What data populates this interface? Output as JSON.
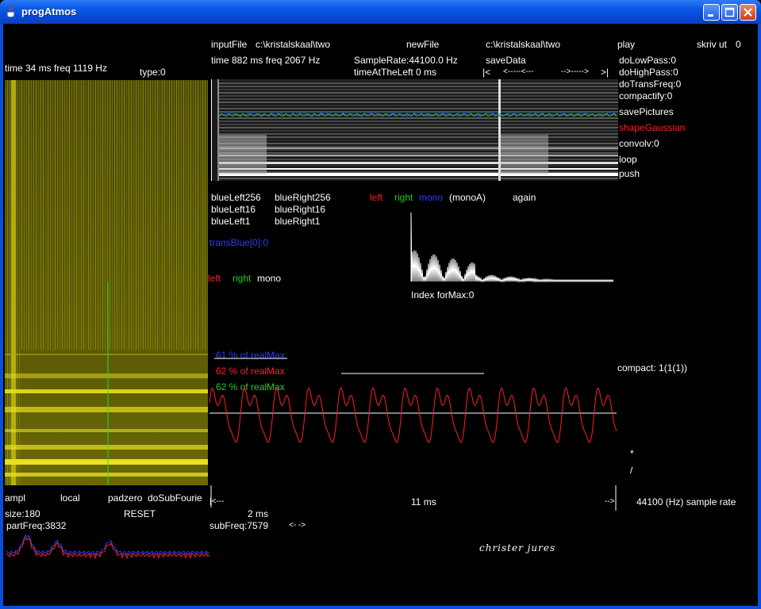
{
  "window": {
    "title": "progAtmos",
    "colors": {
      "titlebar": "#0a5ae8",
      "background": "#000000",
      "yellow": "#e0d818"
    }
  },
  "top": {
    "input_file_label": "inputFile",
    "input_file_path": "c:\\kristalskaal\\two",
    "new_file_label": "newFile",
    "new_file_path": "c:\\kristalskaal\\two",
    "play": "play",
    "skriv_ut": "skriv ut",
    "skriv_ut_value": "0",
    "time_freq_right": "time  882 ms   freq  2067 Hz",
    "sample_rate": "SampleRate:44100.0 Hz",
    "time_at_left": "timeAtTheLeft  0 ms",
    "save_data": "saveData",
    "nav_start": "|<",
    "nav_back": "<-----<---",
    "nav_forward": "-->----->",
    "nav_end": ">|"
  },
  "left": {
    "time_freq": "time  34 ms   freq  1119 Hz",
    "type": "type:0",
    "ampl": "ampl",
    "local": "local",
    "padzero": "padzero",
    "do_sub_fourie": "doSubFourie",
    "size": "size:180",
    "reset": "RESET",
    "part_freq": "partFreq:3832"
  },
  "options": [
    {
      "label": "doLowPass:0",
      "color": "#ffffff"
    },
    {
      "label": "doHighPass:0",
      "color": "#ffffff"
    },
    {
      "label": "doTransFreq:0",
      "color": "#ffffff"
    },
    {
      "label": "compactify:0",
      "color": "#ffffff"
    },
    {
      "label": "savePictures",
      "color": "#ffffff"
    },
    {
      "label": "shapeGaussian",
      "color": "#ff2020"
    },
    {
      "label": "convolv:0",
      "color": "#ffffff"
    },
    {
      "label": "loop",
      "color": "#ffffff"
    },
    {
      "label": "push",
      "color": "#ffffff"
    }
  ],
  "blue": {
    "left256": "blueLeft256",
    "right256": "blueRight256",
    "left16": "blueLeft16",
    "right16": "blueRight16",
    "left1": "blueLeft1",
    "right1": "blueRight1",
    "trans": "transBlue[0]:0"
  },
  "channels": {
    "left": "left",
    "right": "right",
    "mono": "mono",
    "monoA": "(monoA)",
    "again": "again",
    "index_for_max": "Index forMax:0"
  },
  "realmax": {
    "blue": "61 % of realMax",
    "red": "62 % of realMax",
    "green": "62 % of realMax"
  },
  "compact": "compact: 1(1(1))",
  "marks": {
    "star": "*",
    "slash": "/"
  },
  "bottom": {
    "arrow_left": "|<---",
    "ms11": "11 ms",
    "arrow_right": "-->",
    "sample_rate": "44100 (Hz) sample rate",
    "ms2": "2 ms",
    "sub_freq": "subFreq:7579",
    "arrows": "<-   ->",
    "signature": "christer  jures"
  }
}
